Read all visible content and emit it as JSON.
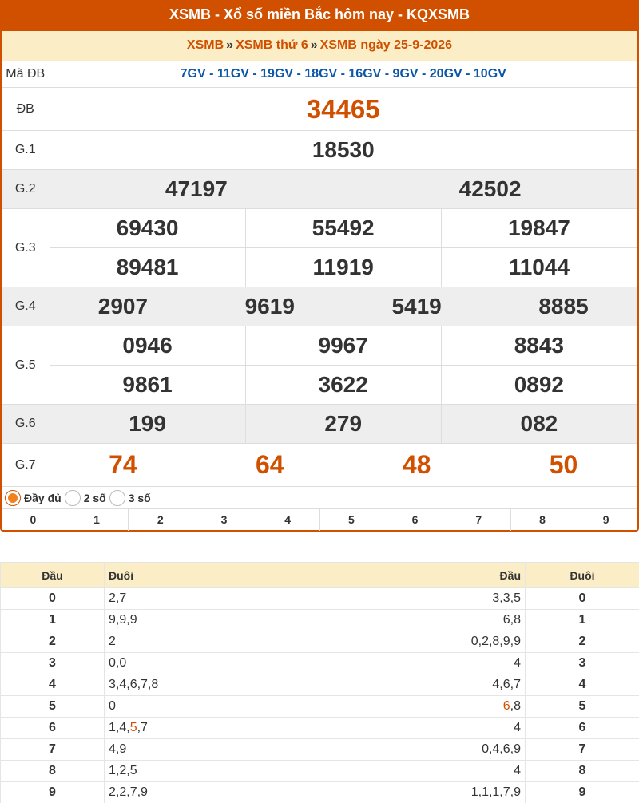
{
  "header": {
    "title": "XSMB - Xổ số miền Bắc hôm nay - KQXSMB",
    "crumbs": [
      "XSMB",
      "XSMB thứ 6",
      "XSMB ngày 25-9-2026"
    ],
    "separator": "»"
  },
  "results": {
    "ma_db_label": "Mã ĐB",
    "ma_db": "7GV - 11GV - 19GV - 18GV - 16GV - 9GV - 20GV - 10GV",
    "db_label": "ĐB",
    "db": "34465",
    "g1_label": "G.1",
    "g1": [
      "18530"
    ],
    "g2_label": "G.2",
    "g2": [
      "47197",
      "42502"
    ],
    "g3_label": "G.3",
    "g3": [
      "69430",
      "55492",
      "19847",
      "89481",
      "11919",
      "11044"
    ],
    "g4_label": "G.4",
    "g4": [
      "2907",
      "9619",
      "5419",
      "8885"
    ],
    "g5_label": "G.5",
    "g5": [
      "0946",
      "9967",
      "8843",
      "9861",
      "3622",
      "0892"
    ],
    "g6_label": "G.6",
    "g6": [
      "199",
      "279",
      "082"
    ],
    "g7_label": "G.7",
    "g7": [
      "74",
      "64",
      "48",
      "50"
    ]
  },
  "options": {
    "items": [
      "Đầy đủ",
      "2 số",
      "3 số"
    ],
    "selected": "Đầy đủ"
  },
  "digit_filter": [
    "0",
    "1",
    "2",
    "3",
    "4",
    "5",
    "6",
    "7",
    "8",
    "9"
  ],
  "loto_table": {
    "headers": [
      "Đầu",
      "Đuôi",
      "Đầu",
      "Đuôi"
    ],
    "rows": [
      {
        "dau": "0",
        "duoi": "2,7",
        "dau2": "3,3,5",
        "duoi2": "0"
      },
      {
        "dau": "1",
        "duoi": "9,9,9",
        "dau2": "6,8",
        "duoi2": "1"
      },
      {
        "dau": "2",
        "duoi": "2",
        "dau2": "0,2,8,9,9",
        "duoi2": "2"
      },
      {
        "dau": "3",
        "duoi": "0,0",
        "dau2": "4",
        "duoi2": "3"
      },
      {
        "dau": "4",
        "duoi": "3,4,6,7,8",
        "dau2": "4,6,7",
        "duoi2": "4"
      },
      {
        "dau": "5",
        "duoi": "0",
        "dau2_hl": "6",
        "dau2_rest": ",8",
        "duoi2": "5"
      },
      {
        "dau": "6",
        "duoi_pre": "1,4,",
        "duoi_hl": "5",
        "duoi_post": ",7",
        "dau2": "4",
        "duoi2": "6"
      },
      {
        "dau": "7",
        "duoi": "4,9",
        "dau2": "0,4,6,9",
        "duoi2": "7"
      },
      {
        "dau": "8",
        "duoi": "1,2,5",
        "dau2": "4",
        "duoi2": "8"
      },
      {
        "dau": "9",
        "duoi": "2,2,7,9",
        "dau2": "1,1,1,7,9",
        "duoi2": "9"
      }
    ]
  },
  "colors": {
    "accent": "#d05000",
    "header_bg": "#fbedc6",
    "ma_db": "#0a56a8"
  }
}
